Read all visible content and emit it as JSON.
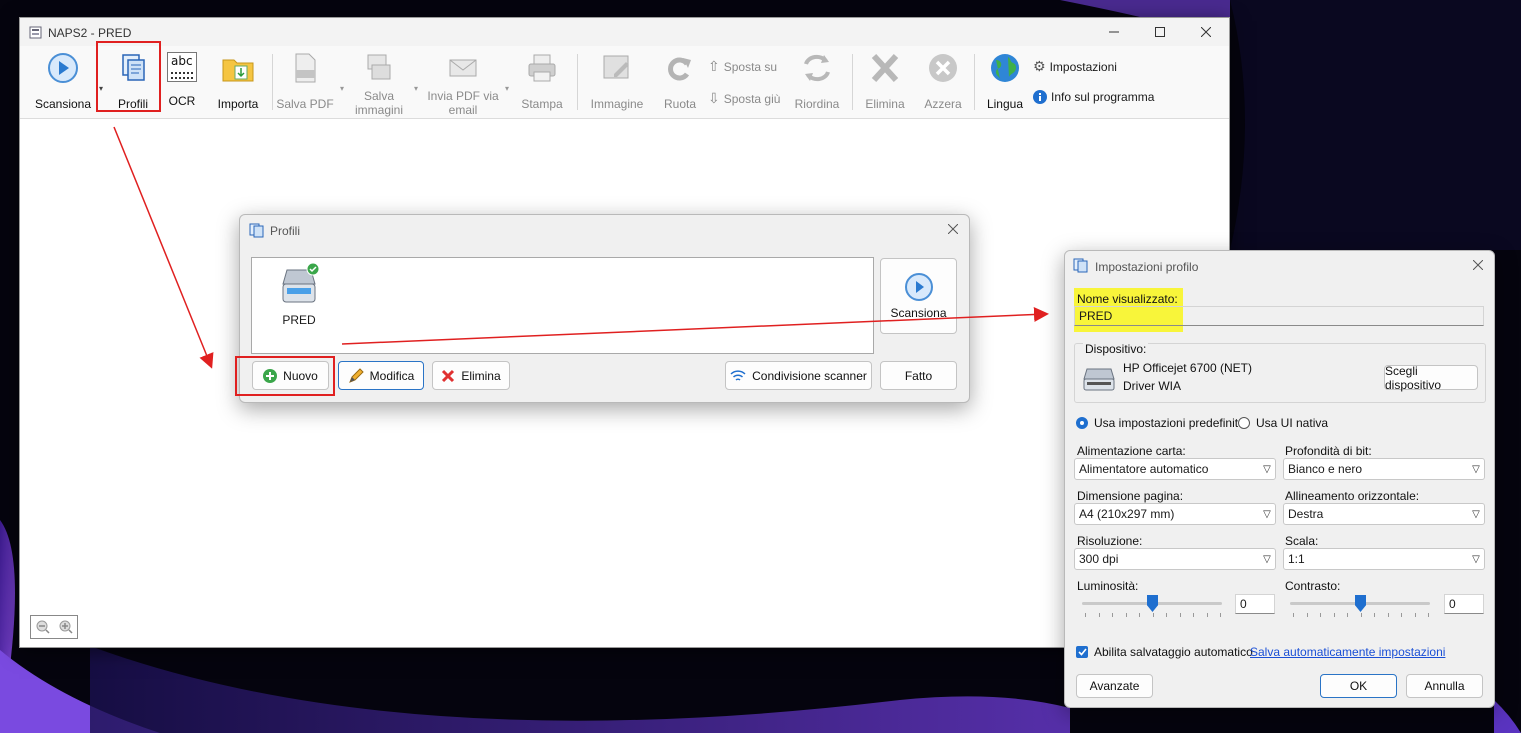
{
  "window": {
    "title": "NAPS2 - PRED"
  },
  "toolbar": {
    "scan_label": "Scansiona",
    "profiles_label": "Profili",
    "ocr_label": "OCR",
    "import_label": "Importa",
    "save_pdf_label": "Salva PDF",
    "save_images_label1": "Salva",
    "save_images_label2": "immagini",
    "email_pdf_label1": "Invia PDF via",
    "email_pdf_label2": "email",
    "print_label": "Stampa",
    "image_label": "Immagine",
    "rotate_label": "Ruota",
    "move_up_label": "Sposta su",
    "move_down_label": "Sposta giù",
    "reorder_label": "Riordina",
    "delete_label": "Elimina",
    "clear_label": "Azzera",
    "language_label": "Lingua",
    "settings_label": "Impostazioni",
    "about_label": "Info sul programma",
    "ocr_icon_text": "abc"
  },
  "profiles_dialog": {
    "title": "Profili",
    "profile_name": "PRED",
    "scan_button": "Scansiona",
    "new_button": "Nuovo",
    "edit_button": "Modifica",
    "delete_button": "Elimina",
    "share_button": "Condivisione scanner",
    "done_button": "Fatto"
  },
  "profile_settings": {
    "title": "Impostazioni profilo",
    "display_name_label": "Nome visualizzato:",
    "display_name_value": "PRED",
    "device_group_label": "Dispositivo:",
    "device_name": "HP Officejet 6700 (NET)",
    "device_driver": "Driver WIA",
    "choose_device_button": "Scegli dispositivo",
    "radio_predefined": "Usa impostazioni predefinite",
    "radio_native": "Usa UI nativa",
    "paper_source_label": "Alimentazione carta:",
    "paper_source_value": "Alimentatore automatico",
    "bit_depth_label": "Profondità di bit:",
    "bit_depth_value": "Bianco e nero",
    "page_size_label": "Dimensione pagina:",
    "page_size_value": "A4 (210x297 mm)",
    "h_align_label": "Allineamento orizzontale:",
    "h_align_value": "Destra",
    "resolution_label": "Risoluzione:",
    "resolution_value": "300 dpi",
    "scale_label": "Scala:",
    "scale_value": "1:1",
    "brightness_label": "Luminosità:",
    "brightness_value": "0",
    "contrast_label": "Contrasto:",
    "contrast_value": "0",
    "autosave_label": "Abilita salvataggio automatico",
    "autosave_link": "Salva automaticamente impostazioni",
    "advanced_button": "Avanzate",
    "ok_button": "OK",
    "cancel_button": "Annulla"
  },
  "colors": {
    "accent": "#1f6fcf",
    "annotation_red": "#e02020",
    "highlight_yellow": "#f8f53a"
  }
}
